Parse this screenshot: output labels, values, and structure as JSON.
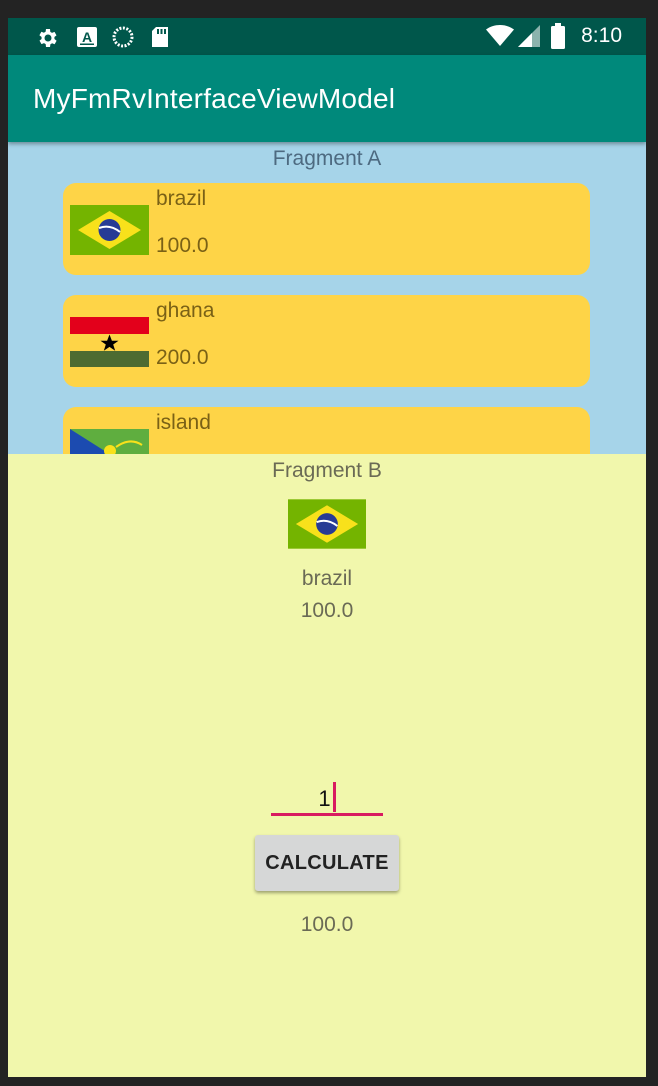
{
  "status_bar": {
    "time": "8:10",
    "left_icons": [
      "gear-icon",
      "a-notification-icon",
      "sync-circle-icon",
      "sd-card-icon"
    ],
    "right_icons": [
      "wifi-icon",
      "signal-icon",
      "battery-icon"
    ]
  },
  "app_bar": {
    "title": "MyFmRvInterfaceViewModel",
    "color": "#00897b"
  },
  "fragment_a": {
    "title": "Fragment A",
    "background": "#a6d4e9",
    "items": [
      {
        "name": "brazil",
        "value": "100.0",
        "flag": "brazil-flag-icon"
      },
      {
        "name": "ghana",
        "value": "200.0",
        "flag": "ghana-flag-icon"
      },
      {
        "name": "island",
        "value": "",
        "flag": "island-flag-icon"
      }
    ]
  },
  "fragment_b": {
    "title": "Fragment B",
    "background": "#f1f7ac",
    "flag": "brazil-flag-icon",
    "name": "brazil",
    "value": "100.0",
    "input_value": "1",
    "calculate_label": "CALCULATE",
    "result": "100.0",
    "accent": "#d81b60"
  }
}
